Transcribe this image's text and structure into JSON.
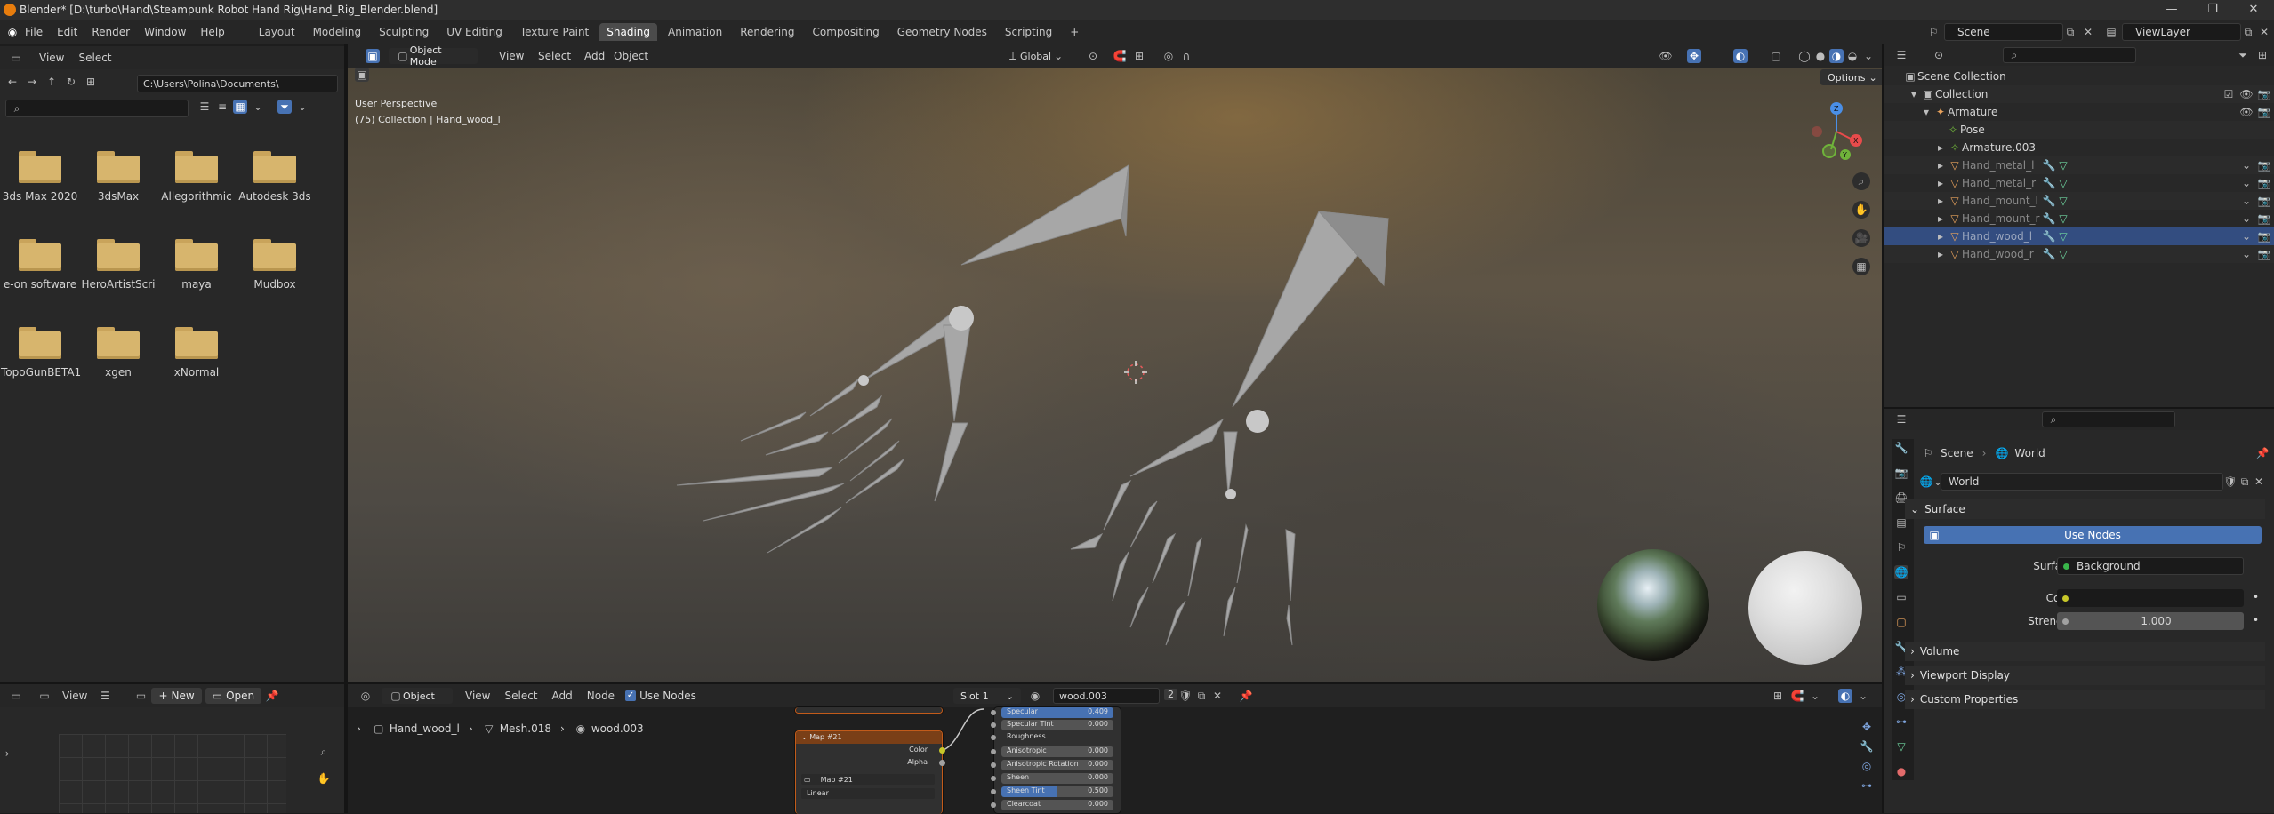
{
  "window": {
    "title": "Blender* [D:\\turbo\\Hand\\Steampunk Robot Hand Rig\\Hand_Rig_Blender.blend]",
    "minimize": "—",
    "maximize": "❐",
    "close": "✕"
  },
  "menu": {
    "items": [
      "File",
      "Edit",
      "Render",
      "Window",
      "Help"
    ],
    "workspaces": [
      "Layout",
      "Modeling",
      "Sculpting",
      "UV Editing",
      "Texture Paint",
      "Shading",
      "Animation",
      "Rendering",
      "Compositing",
      "Geometry Nodes",
      "Scripting"
    ],
    "active_workspace": "Shading",
    "add_tab": "+",
    "scene_label": "Scene",
    "viewlayer_label": "ViewLayer"
  },
  "file_browser": {
    "menu": [
      "View",
      "Select"
    ],
    "path": "C:\\Users\\Polina\\Documents\\",
    "folders": [
      "3ds Max 2020",
      "3dsMax",
      "Allegorithmic",
      "Autodesk 3ds",
      "e-on software",
      "HeroArtistScri",
      "maya",
      "Mudbox",
      "TopoGunBETA1",
      "xgen",
      "xNormal"
    ]
  },
  "viewport": {
    "mode": "Object Mode",
    "menu": [
      "View",
      "Select",
      "Add",
      "Object"
    ],
    "transform_orientation": "Global",
    "options_label": "Options",
    "overlay_line1": "User Perspective",
    "overlay_line2": "(75) Collection | Hand_wood_l",
    "gizmo_axes": {
      "x": "X",
      "y": "Y",
      "z": "Z"
    }
  },
  "outliner": {
    "scene_collection": "Scene Collection",
    "collection": "Collection",
    "armature": "Armature",
    "pose": "Pose",
    "armature_003": "Armature.003",
    "objects": [
      "Hand_metal_l",
      "Hand_metal_r",
      "Hand_mount_l",
      "Hand_mount_r",
      "Hand_wood_l",
      "Hand_wood_r"
    ],
    "selected": "Hand_wood_l"
  },
  "properties": {
    "breadcrumb_scene": "Scene",
    "breadcrumb_world": "World",
    "world_name": "World",
    "surface_panel": "Surface",
    "use_nodes": "Use Nodes",
    "surface_label": "Surface",
    "surface_value": "Background",
    "color_label": "Color",
    "strength_label": "Strength",
    "strength_value": "1.000",
    "volume_panel": "Volume",
    "viewport_display_panel": "Viewport Display",
    "custom_properties_panel": "Custom Properties",
    "accent": "#4772b3"
  },
  "uv_editor": {
    "view": "View",
    "new": "New",
    "open": "Open"
  },
  "node_editor": {
    "object_mode": "Object",
    "menu": [
      "View",
      "Select",
      "Add",
      "Node"
    ],
    "use_nodes": "Use Nodes",
    "slot": "Slot 1",
    "material": "wood.003",
    "users": "2",
    "breadcrumb": [
      "Hand_wood_l",
      "Mesh.018",
      "wood.003"
    ],
    "map_node_title": "Map #21",
    "map_node_image": "Map #21",
    "map_outputs": [
      "Color",
      "Alpha"
    ],
    "map_interp": "Linear",
    "bsdf_rows": [
      {
        "label": "Specular",
        "value": "0.409",
        "highlight": true
      },
      {
        "label": "Specular Tint",
        "value": "0.000",
        "highlight": false
      },
      {
        "label": "Roughness",
        "value": "",
        "highlight": false
      },
      {
        "label": "Anisotropic",
        "value": "0.000",
        "highlight": false
      },
      {
        "label": "Anisotropic Rotation",
        "value": "0.000",
        "highlight": false
      },
      {
        "label": "Sheen",
        "value": "0.000",
        "highlight": false
      },
      {
        "label": "Sheen Tint",
        "value": "0.500",
        "highlight": true
      },
      {
        "label": "Clearcoat",
        "value": "0.000",
        "highlight": false
      }
    ]
  }
}
